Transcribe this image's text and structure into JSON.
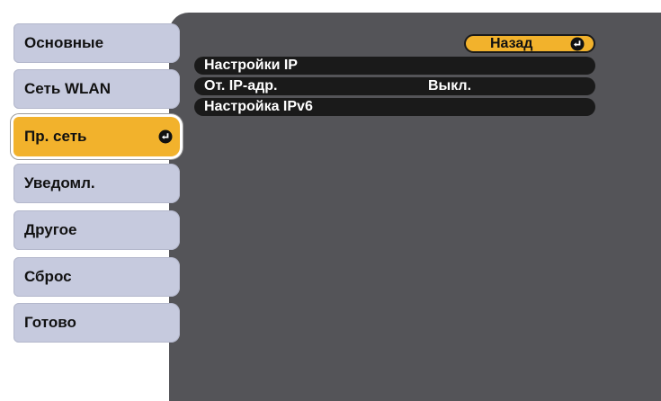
{
  "sidebar": {
    "items": [
      {
        "label": "Основные",
        "selected": false
      },
      {
        "label": "Сеть WLAN",
        "selected": false
      },
      {
        "label": "Пр. сеть",
        "selected": true
      },
      {
        "label": "Уведомл.",
        "selected": false
      },
      {
        "label": "Другое",
        "selected": false
      },
      {
        "label": "Сброс",
        "selected": false
      },
      {
        "label": "Готово",
        "selected": false
      }
    ]
  },
  "main": {
    "back_label": "Назад",
    "rows": [
      {
        "label": "Настройки IP",
        "value": ""
      },
      {
        "label": "От. IP-адр.",
        "value": "Выкл."
      },
      {
        "label": "Настройка IPv6",
        "value": ""
      }
    ]
  },
  "icons": {
    "enter": "enter-icon"
  },
  "colors": {
    "panel": "#545458",
    "tab": "#c6cade",
    "accent": "#f2b22c",
    "row": "#1a1a1a"
  }
}
